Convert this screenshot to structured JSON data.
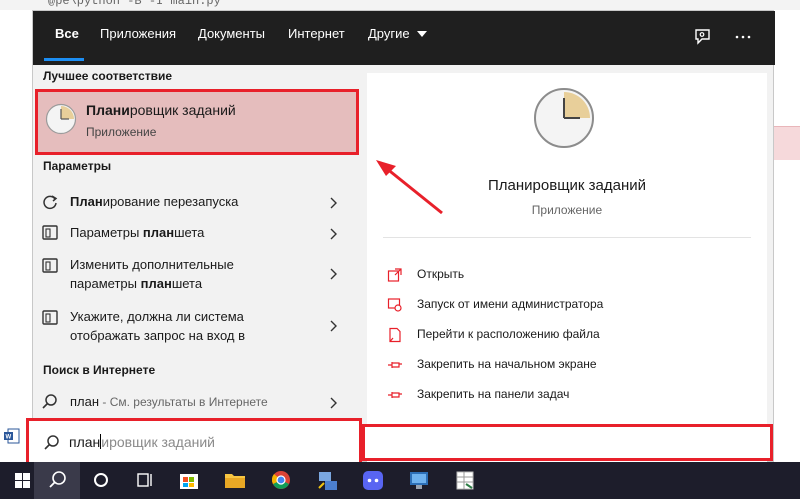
{
  "background": {
    "code_line": "@pe\\python -B -I main.py"
  },
  "tabs": [
    {
      "label": "Все",
      "active": true
    },
    {
      "label": "Приложения"
    },
    {
      "label": "Документы"
    },
    {
      "label": "Интернет"
    },
    {
      "label": "Другие"
    }
  ],
  "toolbar_icons": [
    "feedback-icon",
    "more-options-icon"
  ],
  "left": {
    "best_match_header": "Лучшее соответствие",
    "best_match": {
      "title_bold": "Плани",
      "title_rest": "ровщик заданий",
      "subtitle": "Приложение",
      "icon": "clock-icon"
    },
    "settings_header": "Параметры",
    "settings": [
      {
        "bold": "План",
        "rest": "ирование перезапуска",
        "icon": "restart-icon"
      },
      {
        "pre": "Параметры ",
        "bold": "план",
        "rest": "шета",
        "icon": "tablet-settings-icon"
      },
      {
        "line1": "Изменить дополнительные",
        "line2_pre": "параметры ",
        "line2_bold": "план",
        "line2_rest": "шета",
        "icon": "tablet-settings-icon"
      },
      {
        "line1": "Укажите, должна ли система",
        "line2": "отображать запрос на вход в",
        "icon": "tablet-settings-icon"
      }
    ],
    "web_header": "Поиск в Интернете",
    "web": {
      "query": "план",
      "suffix": " - См. результаты в Интернете",
      "icon": "search-icon"
    }
  },
  "right": {
    "title": "Планировщик заданий",
    "subtitle": "Приложение",
    "actions": [
      {
        "label": "Открыть",
        "icon": "open-icon"
      },
      {
        "label": "Запуск от имени администратора",
        "icon": "run-as-admin-icon"
      },
      {
        "label": "Перейти к расположению файла",
        "icon": "file-location-icon"
      },
      {
        "label": "Закрепить на начальном экране",
        "icon": "pin-icon"
      },
      {
        "label": "Закрепить на панели задач",
        "icon": "pin-icon"
      }
    ]
  },
  "search": {
    "typed": "план",
    "ghost": "ировщик заданий"
  },
  "taskbar": [
    "windows-start-icon",
    "search-icon",
    "cortana-icon",
    "task-view-icon",
    "store-icon",
    "file-explorer-icon",
    "chrome-icon",
    "network-icon",
    "discord-icon",
    "remote-desktop-icon",
    "spreadsheet-icon"
  ],
  "colors": {
    "accent": "#1c8ef3",
    "annotation": "#e8202a",
    "highlight": "#e5bdbd"
  }
}
